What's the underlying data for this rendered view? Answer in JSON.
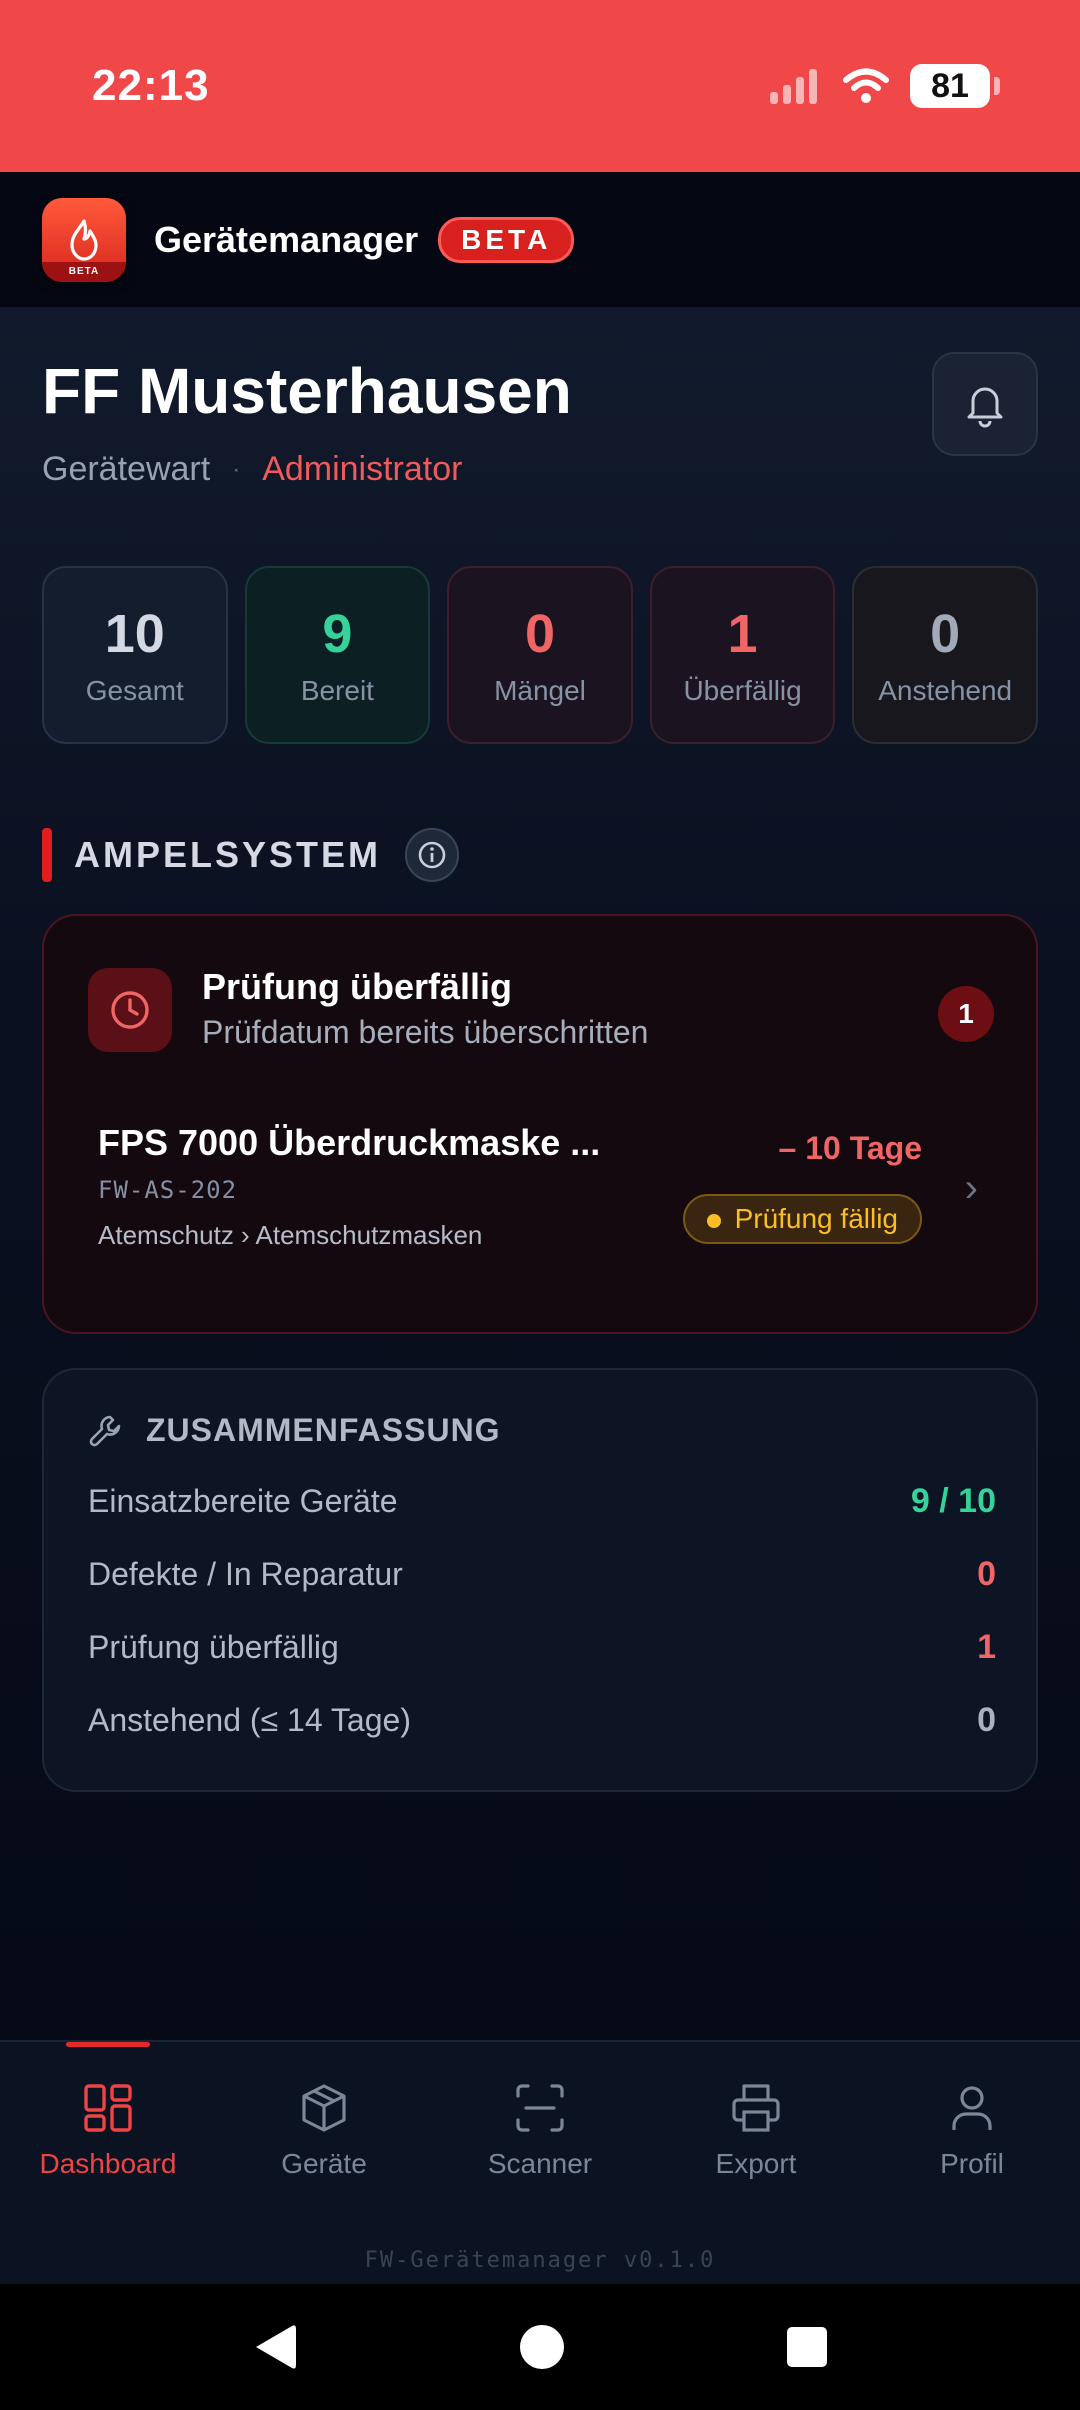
{
  "status_bar": {
    "time": "22:13",
    "battery": "81"
  },
  "app": {
    "title": "Gerätemanager",
    "beta": "BETA",
    "logo_badge": "BETA"
  },
  "header": {
    "org": "FF Musterhausen",
    "role": "Gerätewart",
    "separator": "·",
    "admin": "Administrator"
  },
  "stats": [
    {
      "value": "10",
      "label": "Gesamt"
    },
    {
      "value": "9",
      "label": "Bereit"
    },
    {
      "value": "0",
      "label": "Mängel"
    },
    {
      "value": "1",
      "label": "Überfällig"
    },
    {
      "value": "0",
      "label": "Anstehend"
    }
  ],
  "ampel": {
    "title": "AMPELSYSTEM",
    "alert": {
      "title": "Prüfung überfällig",
      "subtitle": "Prüfdatum bereits überschritten",
      "count": "1",
      "device": {
        "name": "FPS 7000 Überdruckmaske ...",
        "code": "FW-AS-202",
        "category": "Atemschutz › Atemschutzmasken",
        "days": "– 10 Tage",
        "badge": "Prüfung fällig"
      }
    }
  },
  "summary": {
    "title": "ZUSAMMENFASSUNG",
    "rows": [
      {
        "label": "Einsatzbereite Geräte",
        "value": "9 / 10"
      },
      {
        "label": "Defekte / In Reparatur",
        "value": "0"
      },
      {
        "label": "Prüfung überfällig",
        "value": "1"
      },
      {
        "label": "Anstehend (≤ 14 Tage)",
        "value": "0"
      }
    ]
  },
  "nav": {
    "items": [
      {
        "label": "Dashboard",
        "icon": "dashboard-icon"
      },
      {
        "label": "Geräte",
        "icon": "box-icon"
      },
      {
        "label": "Scanner",
        "icon": "scan-icon"
      },
      {
        "label": "Export",
        "icon": "printer-icon"
      },
      {
        "label": "Profil",
        "icon": "user-icon"
      }
    ],
    "version": "FW-Gerätemanager v0.1.0"
  },
  "colors": {
    "accent": "#ef4444",
    "ready": "#35d399",
    "warning": "#fbbf24",
    "status_bar": "#f04848"
  }
}
